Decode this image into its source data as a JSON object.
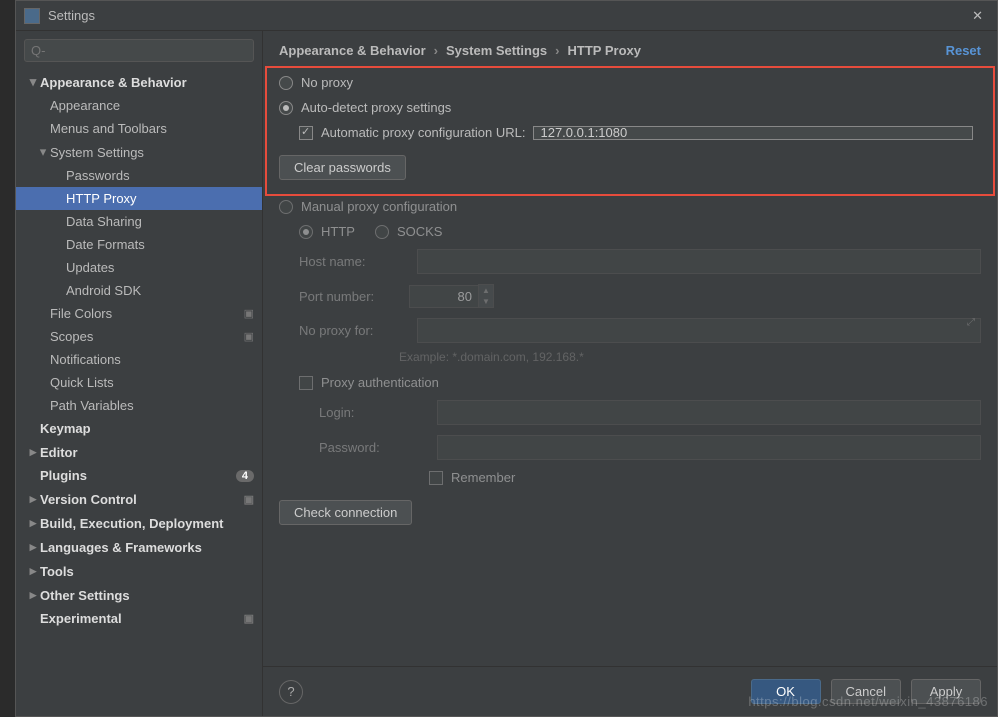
{
  "window": {
    "title": "Settings"
  },
  "search": {
    "placeholder": "Q-"
  },
  "breadcrumbs": {
    "a": "Appearance & Behavior",
    "b": "System Settings",
    "c": "HTTP Proxy",
    "sep": "›",
    "reset": "Reset"
  },
  "tree": {
    "appearance_behavior": "Appearance & Behavior",
    "appearance": "Appearance",
    "menus_toolbars": "Menus and Toolbars",
    "system_settings": "System Settings",
    "passwords": "Passwords",
    "http_proxy": "HTTP Proxy",
    "data_sharing": "Data Sharing",
    "date_formats": "Date Formats",
    "updates": "Updates",
    "android_sdk": "Android SDK",
    "file_colors": "File Colors",
    "scopes": "Scopes",
    "notifications": "Notifications",
    "quick_lists": "Quick Lists",
    "path_variables": "Path Variables",
    "keymap": "Keymap",
    "editor": "Editor",
    "plugins": "Plugins",
    "plugins_badge": "4",
    "version_control": "Version Control",
    "bed": "Build, Execution, Deployment",
    "lang_fw": "Languages & Frameworks",
    "tools": "Tools",
    "other_settings": "Other Settings",
    "experimental": "Experimental"
  },
  "proxy": {
    "no_proxy": "No proxy",
    "auto_detect": "Auto-detect proxy settings",
    "auto_url_label": "Automatic proxy configuration URL:",
    "auto_url_value": "127.0.0.1:1080",
    "clear_passwords": "Clear passwords",
    "manual": "Manual proxy configuration",
    "http": "HTTP",
    "socks": "SOCKS",
    "host_name": "Host name:",
    "port_number": "Port number:",
    "port_value": "80",
    "no_proxy_for": "No proxy for:",
    "example": "Example: *.domain.com, 192.168.*",
    "proxy_auth": "Proxy authentication",
    "login": "Login:",
    "password": "Password:",
    "remember": "Remember",
    "check_connection": "Check connection"
  },
  "footer": {
    "ok": "OK",
    "cancel": "Cancel",
    "apply": "Apply",
    "help": "?"
  },
  "watermark": "https://blog.csdn.net/weixin_43876186"
}
